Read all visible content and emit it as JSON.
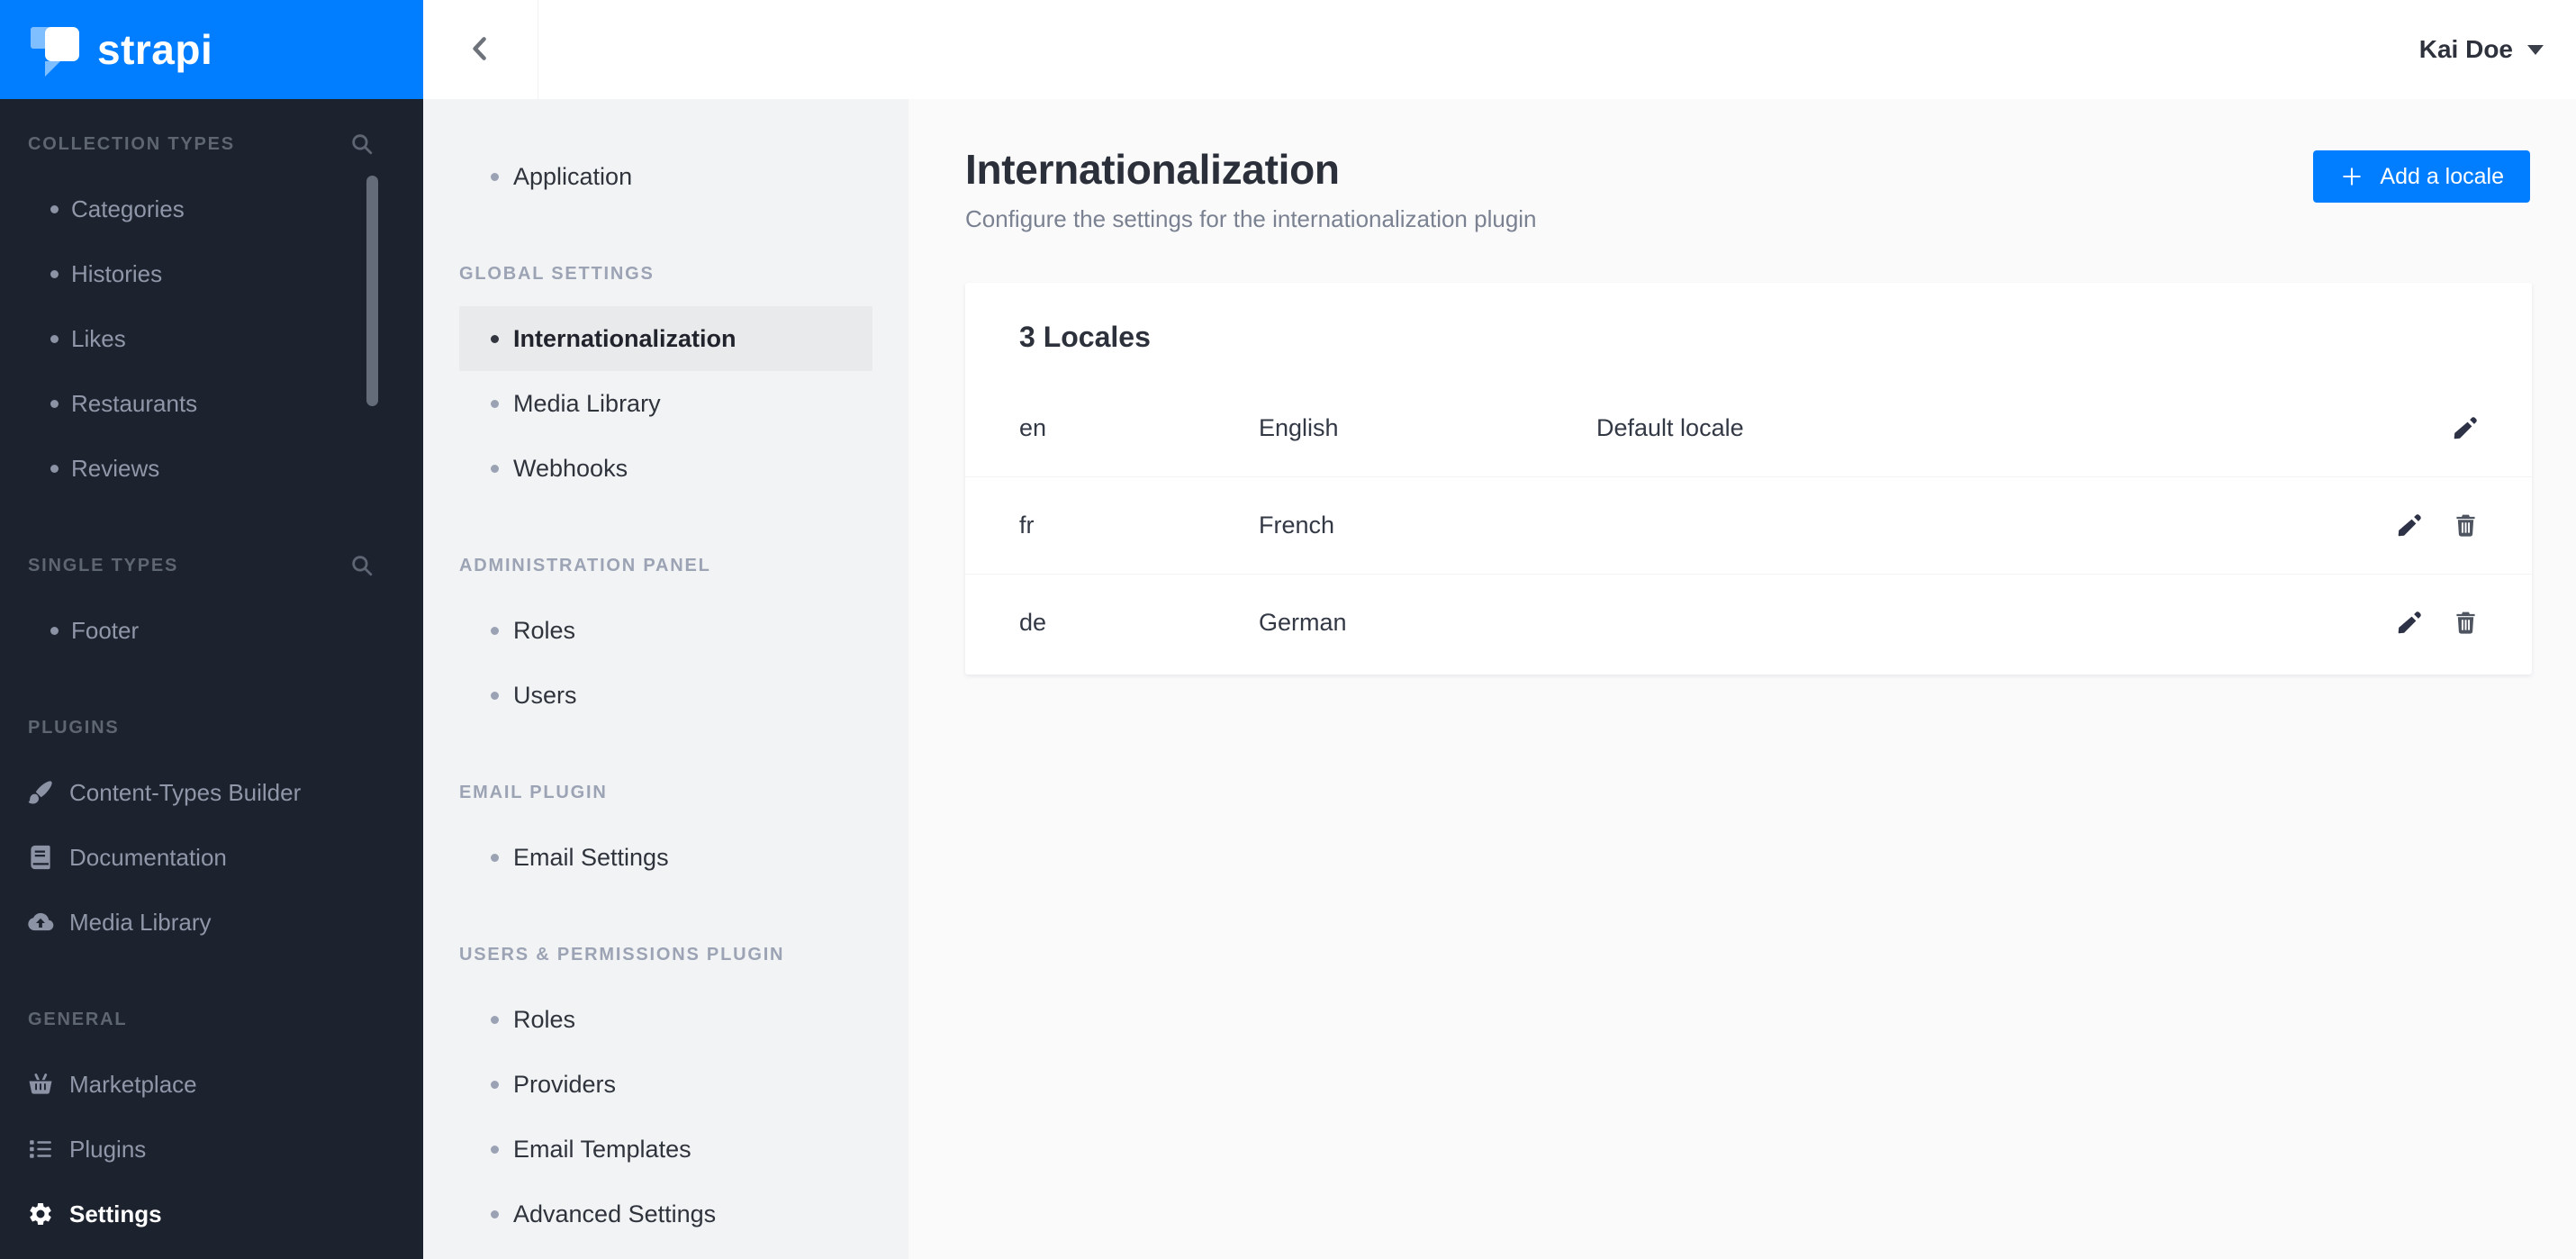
{
  "brand": {
    "logo_text": "strapi"
  },
  "topbar": {
    "user_name": "Kai Doe"
  },
  "main_sidebar": {
    "sections": [
      {
        "label": "COLLECTION TYPES",
        "has_search": true,
        "items": [
          {
            "label": "Categories"
          },
          {
            "label": "Histories"
          },
          {
            "label": "Likes"
          },
          {
            "label": "Restaurants"
          },
          {
            "label": "Reviews"
          }
        ]
      },
      {
        "label": "SINGLE TYPES",
        "has_search": true,
        "items": [
          {
            "label": "Footer"
          }
        ]
      },
      {
        "label": "PLUGINS",
        "has_search": false,
        "items": [
          {
            "label": "Content-Types Builder",
            "icon": "paint-brush-icon"
          },
          {
            "label": "Documentation",
            "icon": "book-icon"
          },
          {
            "label": "Media Library",
            "icon": "cloud-upload-icon"
          }
        ]
      },
      {
        "label": "GENERAL",
        "has_search": false,
        "items": [
          {
            "label": "Marketplace",
            "icon": "shopping-basket-icon"
          },
          {
            "label": "Plugins",
            "icon": "list-icon"
          },
          {
            "label": "Settings",
            "icon": "gear-icon",
            "active": true
          }
        ]
      }
    ]
  },
  "settings_sidebar": {
    "top_items": [
      {
        "label": "Application"
      }
    ],
    "sections": [
      {
        "label": "GLOBAL SETTINGS",
        "items": [
          {
            "label": "Internationalization",
            "active": true
          },
          {
            "label": "Media Library"
          },
          {
            "label": "Webhooks"
          }
        ]
      },
      {
        "label": "ADMINISTRATION PANEL",
        "items": [
          {
            "label": "Roles"
          },
          {
            "label": "Users"
          }
        ]
      },
      {
        "label": "EMAIL PLUGIN",
        "items": [
          {
            "label": "Email Settings"
          }
        ]
      },
      {
        "label": "USERS & PERMISSIONS PLUGIN",
        "items": [
          {
            "label": "Roles"
          },
          {
            "label": "Providers"
          },
          {
            "label": "Email Templates"
          },
          {
            "label": "Advanced Settings"
          }
        ]
      }
    ]
  },
  "content": {
    "title": "Internationalization",
    "subtitle": "Configure the settings for the internationalization plugin",
    "add_button": {
      "label": "Add a locale",
      "icon": "plus-icon"
    },
    "locales_card": {
      "heading": "3 Locales",
      "rows": [
        {
          "code": "en",
          "name": "English",
          "note": "Default locale",
          "can_delete": false
        },
        {
          "code": "fr",
          "name": "French",
          "note": "",
          "can_delete": true
        },
        {
          "code": "de",
          "name": "German",
          "note": "",
          "can_delete": true
        }
      ]
    }
  },
  "colors": {
    "accent_blue": "#007EFF",
    "dark_sidebar_bg": "#1C222E",
    "light_sidebar_bg": "#F2F3F4",
    "content_bg": "#FAFAFB",
    "active_item_bg": "#E9EAEB",
    "card_bg": "#FFFFFF",
    "title_text": "#2B2F3A",
    "muted_text": "#7A8191"
  }
}
